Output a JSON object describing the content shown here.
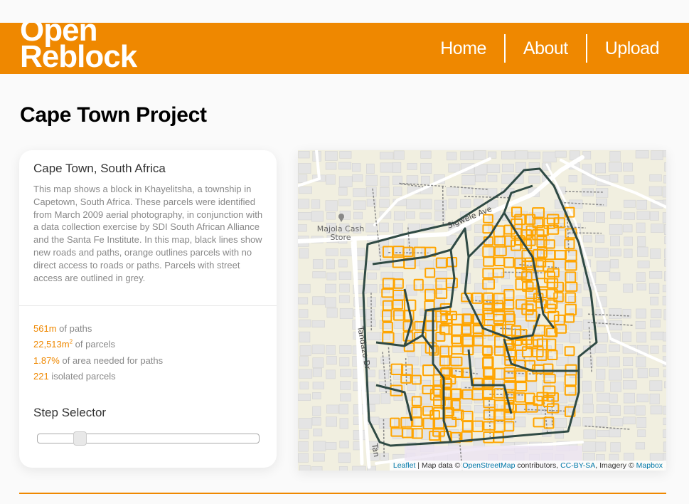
{
  "header": {
    "logo_line1": "Open",
    "logo_line2": "Reblock",
    "nav": [
      {
        "label": "Home"
      },
      {
        "label": "About"
      },
      {
        "label": "Upload"
      }
    ]
  },
  "page_title": "Cape Town Project",
  "info_card": {
    "title": "Cape Town, South Africa",
    "description": "This map shows a block in Khayelitsha, a township in Capetown, South Africa. These parcels were identified from March 2009 aerial photography, in conjunction with a data collection exercise by SDI South African Alliance and the Santa Fe Institute. In this map, black lines show new roads and paths, orange outlines parcels with no direct access to roads or paths. Parcels with street access are outlined in grey.",
    "stats": [
      {
        "value": "561m",
        "label": " of paths"
      },
      {
        "value": "22,513m",
        "sup": "2",
        "label": " of parcels"
      },
      {
        "value": "1.87%",
        "label": " of area needed for paths"
      },
      {
        "value": "221",
        "label": " isolated parcels"
      }
    ],
    "step_selector": {
      "label": "Step Selector",
      "value_fraction": 0.17
    }
  },
  "map": {
    "labels": {
      "store_line1": "Majola Cash",
      "store_line2": "Store",
      "road_sigwele": "Sigwele Ave",
      "road_tandazo": "Tandazo Dr",
      "road_tan": "Tan"
    },
    "attribution": {
      "leaflet": "Leaflet",
      "sep": " | Map data © ",
      "osm": "OpenStreetMap",
      "contributors": " contributors, ",
      "license": "CC-BY-SA",
      "imagery": ", Imagery © ",
      "mapbox": "Mapbox"
    },
    "colors": {
      "background": "#f1efe0",
      "building": "#e4e4e4",
      "road": "#ffffff",
      "new_path": "#2f4a44",
      "isolated_parcel": "#ffa500",
      "footpath": "#888888"
    }
  },
  "colors": {
    "brand": "#ef8800"
  }
}
